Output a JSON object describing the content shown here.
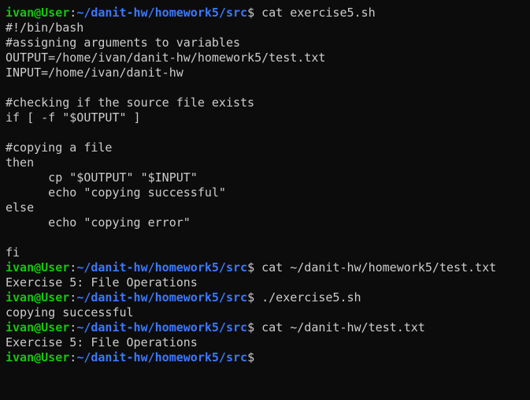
{
  "colors": {
    "background": "#0c0c0c",
    "foreground": "#cccccc",
    "user_host": "#16c60c",
    "path": "#3b78ff"
  },
  "prompt": {
    "user_host": "ivan@User",
    "separator": ":",
    "path": "~/danit-hw/homework5/src",
    "symbol": "$"
  },
  "lines": [
    {
      "type": "prompt",
      "command": " cat exercise5.sh"
    },
    {
      "type": "output",
      "text": "#!/bin/bash"
    },
    {
      "type": "output",
      "text": "#assigning arguments to variables"
    },
    {
      "type": "output",
      "text": "OUTPUT=/home/ivan/danit-hw/homework5/test.txt"
    },
    {
      "type": "output",
      "text": "INPUT=/home/ivan/danit-hw"
    },
    {
      "type": "output",
      "text": ""
    },
    {
      "type": "output",
      "text": "#checking if the source file exists"
    },
    {
      "type": "output",
      "text": "if [ -f \"$OUTPUT\" ]"
    },
    {
      "type": "output",
      "text": ""
    },
    {
      "type": "output",
      "text": "#copying a file"
    },
    {
      "type": "output",
      "text": "then"
    },
    {
      "type": "output",
      "text": "      cp \"$OUTPUT\" \"$INPUT\""
    },
    {
      "type": "output",
      "text": "      echo \"copying successful\""
    },
    {
      "type": "output",
      "text": "else"
    },
    {
      "type": "output",
      "text": "      echo \"copying error\""
    },
    {
      "type": "output",
      "text": ""
    },
    {
      "type": "output",
      "text": "fi"
    },
    {
      "type": "prompt",
      "command": " cat ~/danit-hw/homework5/test.txt"
    },
    {
      "type": "output",
      "text": "Exercise 5: File Operations"
    },
    {
      "type": "prompt",
      "command": " ./exercise5.sh"
    },
    {
      "type": "output",
      "text": "copying successful"
    },
    {
      "type": "prompt",
      "command": " cat ~/danit-hw/test.txt"
    },
    {
      "type": "output",
      "text": "Exercise 5: File Operations"
    },
    {
      "type": "prompt",
      "command": ""
    }
  ]
}
